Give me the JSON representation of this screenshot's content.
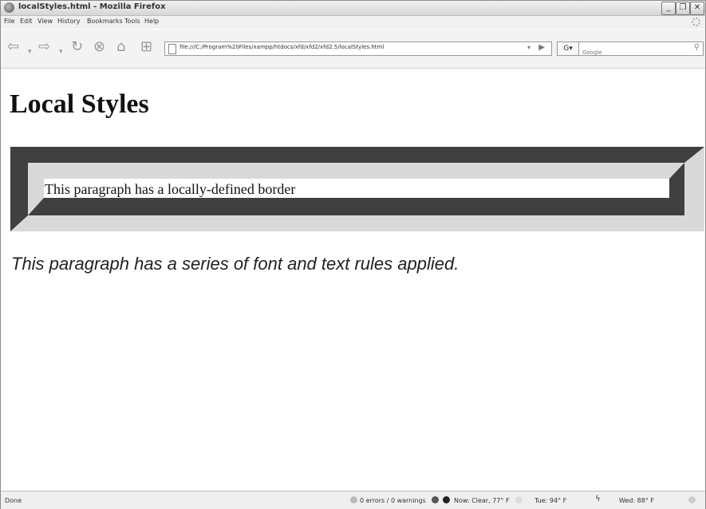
{
  "window": {
    "title": "localStyles.html - Mozilla Firefox"
  },
  "menu": [
    "File",
    "Edit",
    "View",
    "History",
    "Bookmarks",
    "Tools",
    "Help"
  ],
  "toolbar": {
    "url": "file:///C:/Program%20Files/xampp/htdocs/xfd/xfd2/xfd2.5/localStyles.html",
    "search_engine": "G",
    "search_placeholder": "Google"
  },
  "page": {
    "heading": "Local Styles",
    "bordered_paragraph": "This paragraph has a locally-defined border",
    "italic_paragraph": "This paragraph has a series of font and text rules applied."
  },
  "status": {
    "left": "Done",
    "errors": "0 errors / 0 warnings",
    "weather_now": "Now: Clear, 77° F",
    "weather_tue": "Tue: 94° F",
    "weather_wed": "Wed: 88° F"
  },
  "colors": {
    "border_dark": "#404040",
    "border_light": "#d9d9d9"
  }
}
